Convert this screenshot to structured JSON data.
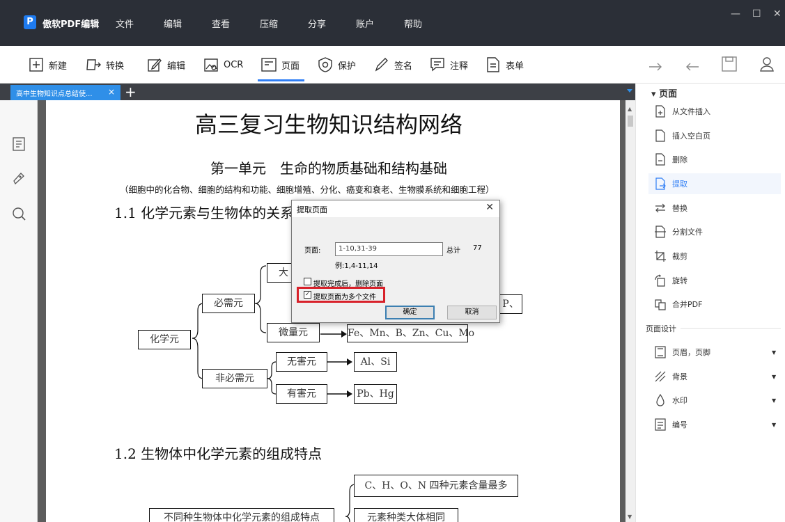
{
  "app": {
    "logo_letter": "P",
    "title": "傲软PDF编辑"
  },
  "menu": [
    "文件",
    "编辑",
    "查看",
    "压缩",
    "分享",
    "账户",
    "帮助"
  ],
  "window_controls": {
    "minimize": "—",
    "maximize": "☐",
    "close": "✕"
  },
  "toolbar": {
    "items": [
      {
        "label": "新建",
        "icon": "plus-box-icon"
      },
      {
        "label": "转换",
        "icon": "convert-icon"
      },
      {
        "label": "编辑",
        "icon": "edit-icon"
      },
      {
        "label": "OCR",
        "icon": "ocr-icon"
      },
      {
        "label": "页面",
        "icon": "page-icon"
      },
      {
        "label": "保护",
        "icon": "shield-icon"
      },
      {
        "label": "签名",
        "icon": "pen-icon"
      },
      {
        "label": "注释",
        "icon": "comment-icon"
      },
      {
        "label": "表单",
        "icon": "form-icon"
      }
    ],
    "active_index": 4,
    "accent_color": "#2f7ef5"
  },
  "tabs": {
    "doc_tab_label": "高中生物知识点总结使...",
    "close": "×",
    "add": "+"
  },
  "right_panel": {
    "section_page": "页面",
    "page_items": [
      "从文件插入",
      "插入空白页",
      "删除",
      "提取",
      "替换",
      "分割文件",
      "裁剪",
      "旋转",
      "合并PDF"
    ],
    "active_item": "提取",
    "section_design": "页面设计",
    "design_items": [
      "页眉，页脚",
      "背景",
      "水印",
      "编号"
    ]
  },
  "document": {
    "title": "高三复习生物知识结构网络",
    "unit": "第一单元　生命的物质基础和结构基础",
    "unit_sub": "（细胞中的化合物、细胞的结构和功能、细胞增殖、分化、癌变和衰老、生物膜系统和细胞工程）",
    "h1": "1.1 化学元素与生物体的关系",
    "h2": "1.2 生物体中化学元素的组成特点",
    "diagram": {
      "root": "化学元",
      "essential": "必需元",
      "macro_partial": "大",
      "micro": "微量元",
      "micro_list": "Fe、Mn、B、Zn、Cu、Mo",
      "p_partial": "P、",
      "nonessential": "非必需元",
      "harmless": "无害元",
      "harmless_list": "Al、Si",
      "harmful": "有害元",
      "harmful_list": "Pb、Hg",
      "diff_label": "不同种生物体中化学元素的组成特点",
      "chno": "C、H、O、N 四种元素含量最多",
      "types_same": "元素种类大体相同"
    }
  },
  "dialog": {
    "title": "提取页面",
    "close": "✕",
    "page_label": "页面:",
    "page_value": "1-10,31-39",
    "total_label": "总计",
    "total_value": "77",
    "example": "例:1,4-11,14",
    "opt_delete": "提取完成后，删除页面",
    "opt_delete_checked": false,
    "opt_multi": "提取页面为多个文件",
    "opt_multi_checked": true,
    "ok": "确定",
    "cancel": "取消"
  }
}
